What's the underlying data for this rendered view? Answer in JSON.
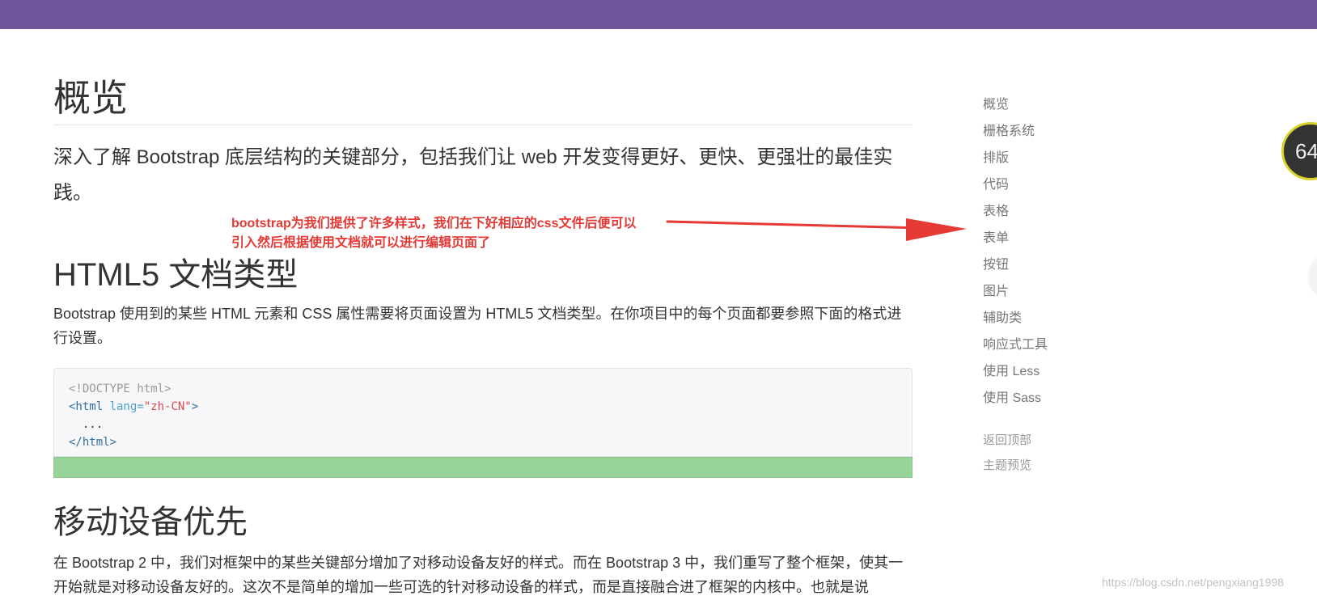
{
  "header": {
    "color": "#6f5499"
  },
  "main": {
    "title": "概览",
    "lead": "深入了解 Bootstrap 底层结构的关键部分，包括我们让 web 开发变得更好、更快、更强壮的最佳实践。",
    "html5": {
      "title": "HTML5 文档类型",
      "desc": "Bootstrap 使用到的某些 HTML 元素和 CSS 属性需要将页面设置为 HTML5 文档类型。在你项目中的每个页面都要参照下面的格式进行设置。",
      "code": {
        "line1": "<!DOCTYPE html>",
        "line2_tag_open": "<html ",
        "line2_attr": "lang=",
        "line2_value": "\"zh-CN\"",
        "line2_tag_close": ">",
        "line3": "  ...",
        "line4": "</html>"
      }
    },
    "mobile": {
      "title": "移动设备优先",
      "desc": "在 Bootstrap 2 中，我们对框架中的某些关键部分增加了对移动设备友好的样式。而在 Bootstrap 3 中，我们重写了整个框架，使其一开始就是对移动设备友好的。这次不是简单的增加一些可选的针对移动设备的样式，而是直接融合进了框架的内核中。也就是说"
    }
  },
  "annotation": {
    "line1": "bootstrap为我们提供了许多样式，我们在下好相应的css文件后便可以",
    "line2": "引入然后根据使用文档就可以进行编辑页面了",
    "color": "#e53935"
  },
  "sidebar": {
    "items": [
      {
        "label": "概览"
      },
      {
        "label": "栅格系统"
      },
      {
        "label": "排版"
      },
      {
        "label": "代码"
      },
      {
        "label": "表格"
      },
      {
        "label": "表单"
      },
      {
        "label": "按钮"
      },
      {
        "label": "图片"
      },
      {
        "label": "辅助类"
      },
      {
        "label": "响应式工具"
      },
      {
        "label": "使用 Less"
      },
      {
        "label": "使用 Sass"
      }
    ],
    "secondary": [
      {
        "label": "返回顶部"
      },
      {
        "label": "主题预览"
      }
    ]
  },
  "floating_badge": {
    "text": "64"
  },
  "watermark": {
    "text": "https://blog.csdn.net/pengxiang1998"
  }
}
